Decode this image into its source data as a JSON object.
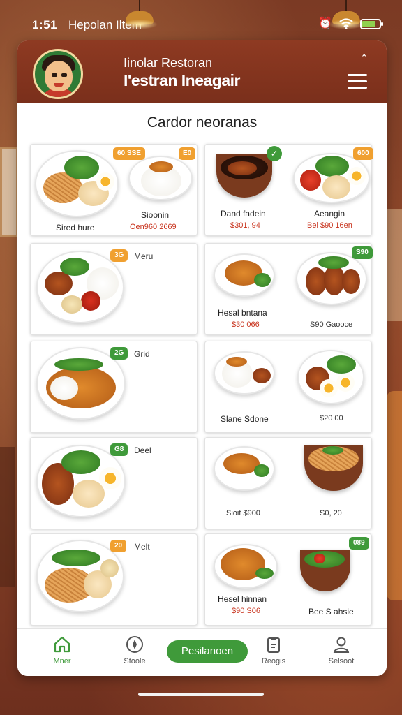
{
  "status": {
    "time": "1:51",
    "carrier": "Hepolan Iltem",
    "icons": [
      "alarm-icon",
      "wifi-icon",
      "battery-icon"
    ]
  },
  "header": {
    "subtitle": "Iinolar Restoran",
    "title": "I'estran Ineagair",
    "logo": "chef-mascot-logo"
  },
  "section_title": "Cardor neoranas",
  "menu": [
    {
      "badge": "60 SSE",
      "badge_color": "orange",
      "name": "Sired hure",
      "price": "",
      "variant": "noodle-rice"
    },
    {
      "badge": "E0",
      "badge_color": "orange",
      "name": "Sioonin",
      "price": "Oen960 2669",
      "variant": "rice-bowl"
    },
    {
      "badge": "",
      "badge_color": "green",
      "name": "Dand fadein",
      "price": "$301, 94",
      "variant": "stew-bowl"
    },
    {
      "badge": "600",
      "badge_color": "orange",
      "name": "Aeangin",
      "price": "Bei $90 16en",
      "variant": "mixed-plate"
    },
    {
      "badge": "3G",
      "badge_color": "orange",
      "badge_word": "Meru",
      "name": "",
      "price": "",
      "variant": "rice-combo"
    },
    {
      "badge": "",
      "badge_color": "",
      "name": "Hesal bntana",
      "price": "$30 066",
      "variant": "curry-bowl"
    },
    {
      "badge": "S90",
      "badge_color": "green",
      "name": "",
      "price": "S90 Gaooce",
      "price_dark": true,
      "variant": "fried-chicken"
    },
    {
      "badge": "2G",
      "badge_color": "green",
      "badge_word": "Grid",
      "name": "",
      "price": "",
      "variant": "stir-fry"
    },
    {
      "badge": "",
      "badge_color": "",
      "name": "Slane Sdone",
      "price": "",
      "variant": "rice-side"
    },
    {
      "badge": "",
      "badge_color": "",
      "name": "",
      "price": "$20 00",
      "price_dark": true,
      "variant": "egg-plate"
    },
    {
      "badge": "G8",
      "badge_color": "green",
      "badge_word": "Deel",
      "name": "",
      "price": "",
      "variant": "satay-plate"
    },
    {
      "badge": "",
      "badge_color": "",
      "name": "",
      "price": "Sioit $900",
      "price_dark": true,
      "variant": "soup-bowl"
    },
    {
      "badge": "",
      "badge_color": "",
      "name": "",
      "price": "S0, 20",
      "price_dark": true,
      "variant": "noodle-bowl"
    },
    {
      "badge": "20",
      "badge_color": "orange",
      "badge_word": "Melt",
      "name": "",
      "price": "",
      "variant": "noodle-veg"
    },
    {
      "badge": "",
      "badge_color": "",
      "name": "Hesel hinnan",
      "price": "$90 S06",
      "variant": "fried-rice"
    },
    {
      "badge": "089",
      "badge_color": "green",
      "name": "Bee S ahsie",
      "price": "",
      "price_dark": true,
      "variant": "salad-bowl"
    }
  ],
  "bottom_nav": {
    "items": [
      {
        "label": "Mner",
        "icon": "home-icon"
      },
      {
        "label": "Stoole",
        "icon": "compass-icon"
      },
      {
        "label": "Reogis",
        "icon": "clipboard-icon"
      },
      {
        "label": "Selsoot",
        "icon": "user-icon"
      }
    ],
    "cta_label": "Pesilanoen"
  },
  "colors": {
    "brand_red": "#7a2f1b",
    "accent_green": "#3f9a3a",
    "badge_orange": "#f0a030",
    "price_red": "#c8321c"
  }
}
